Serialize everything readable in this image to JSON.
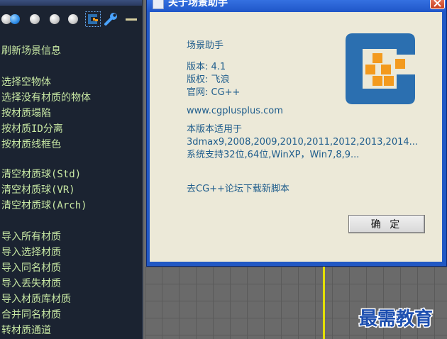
{
  "menu": {
    "items": [
      "刷新场景信息",
      "选择空物体",
      "选择没有材质的物体",
      "按材质塌陷",
      "按材质ID分离",
      "按材质线框色",
      "清空材质球(Std)",
      "清空材质球(VR)",
      "清空材质球(Arch)",
      "导入所有材质",
      "导入选择材质",
      "导入同名材质",
      "导入丢失材质",
      "导入材质库材质",
      "合并同名材质",
      "转材质通道"
    ]
  },
  "dialog": {
    "title": "关于场景助手",
    "app_name": "场景助手",
    "version": "版本: 4.1",
    "copyright": "版权: 飞浪",
    "website_label": "官网: CG++",
    "url": "www.cgplusplus.com",
    "compat_heading": "本版本适用于",
    "compat_max": "3dmax9,2008,2009,2010,2011,2012,2013,2014...",
    "compat_os": "系统支持32位,64位,WinXP，Win7,8,9...",
    "download_link": "去CG++论坛下载新脚本",
    "ok_label": "确 定",
    "logo_color_blue": "#2b6fb0",
    "logo_color_orange": "#f39a1e"
  },
  "watermark": {
    "text": "最需教育"
  }
}
